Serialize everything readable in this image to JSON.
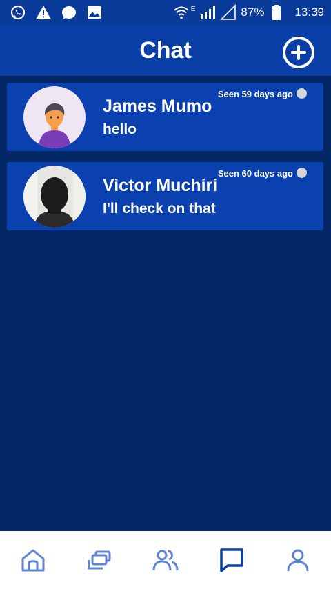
{
  "status_bar": {
    "battery": "87%",
    "time": "13:39",
    "network_type": "E",
    "icons_left": [
      "whatsapp-icon",
      "warning-icon",
      "chat-bubble-icon",
      "image-icon"
    ],
    "icons_right": [
      "wifi-icon",
      "signal-icon",
      "signal-empty-icon",
      "battery-icon"
    ]
  },
  "header": {
    "title": "Chat",
    "add_icon": "plus-circle-icon"
  },
  "chats": [
    {
      "name": "James Mumo",
      "message": "hello",
      "seen": "Seen 59 days ago",
      "avatar": "default-person"
    },
    {
      "name": "Victor Muchiri",
      "message": "I'll check on that",
      "seen": "Seen 60 days ago",
      "avatar": "photo"
    }
  ],
  "bottom_nav": {
    "items": [
      "home-icon",
      "gallery-icon",
      "users-icon",
      "chat-icon",
      "profile-icon"
    ],
    "active": "chat-icon"
  },
  "colors": {
    "background": "#022764",
    "header": "#0A3FA8",
    "card": "#0B40AF",
    "nav_icon": "#5E83D6",
    "nav_active": "#0A3FA8"
  }
}
